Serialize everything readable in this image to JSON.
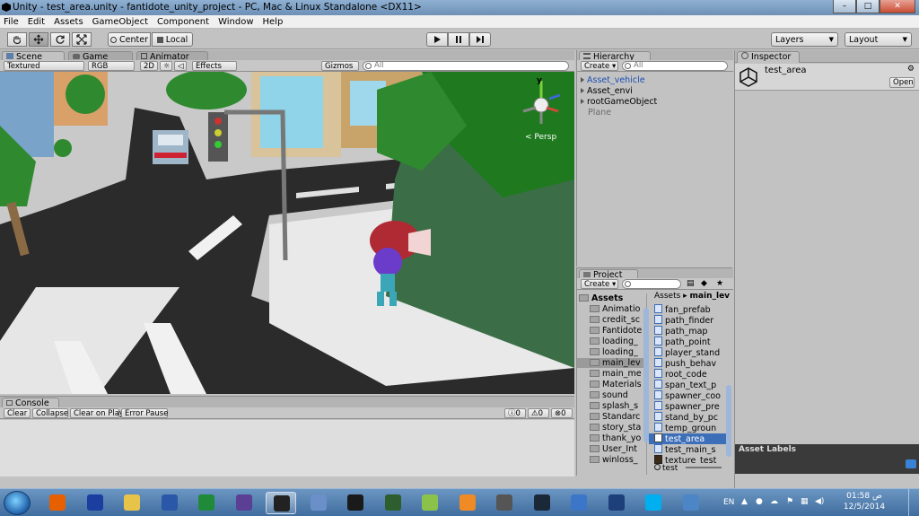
{
  "window": {
    "title": "Unity - test_area.unity - fantidote_unity_project - PC, Mac & Linux Standalone <DX11>",
    "buttons": [
      "minimize",
      "maximize",
      "close"
    ]
  },
  "menu": [
    "File",
    "Edit",
    "Assets",
    "GameObject",
    "Component",
    "Window",
    "Help"
  ],
  "toolbar": {
    "tools": [
      "hand-tool",
      "move-tool",
      "rotate-tool",
      "scale-tool"
    ],
    "pivot": "Center",
    "space": "Local",
    "playback": [
      "play",
      "pause",
      "step"
    ],
    "layers": "Layers",
    "layout": "Layout"
  },
  "scene_tabs": [
    "Scene",
    "Game",
    "Animator"
  ],
  "scene_toolbar": {
    "render_mode": "Textured",
    "channel": "RGB",
    "mode_2d": "2D",
    "effects": "Effects",
    "gizmos": "Gizmos",
    "search_placeholder": "All"
  },
  "scene_view": {
    "persp_label": "Persp",
    "gizmo_axis": "y"
  },
  "hierarchy": {
    "tab": "Hierarchy",
    "create": "Create",
    "search_placeholder": "All",
    "items": [
      {
        "label": "Asset_vehicle",
        "state": "selected"
      },
      {
        "label": "Asset_envi",
        "state": "normal"
      },
      {
        "label": "rootGameObject",
        "state": "normal"
      },
      {
        "label": "Plane",
        "state": "dim"
      }
    ]
  },
  "inspector": {
    "tab": "Inspector",
    "object_name": "test_area",
    "open_button": "Open",
    "asset_labels": "Asset Labels"
  },
  "project": {
    "tab": "Project",
    "create": "Create",
    "breadcrumb_root": "Assets",
    "breadcrumb_current": "main_lev",
    "folders": [
      "Assets",
      "Animatio",
      "credit_sc",
      "Fantidote",
      "loading_",
      "loading_",
      "main_lev",
      "main_me",
      "Materials",
      "sound",
      "splash_s",
      "Standarc",
      "story_sta",
      "thank_yo",
      "User_Int",
      "winloss_"
    ],
    "files": [
      {
        "label": "fan_prefab",
        "icon": "script"
      },
      {
        "label": "path_finder",
        "icon": "script"
      },
      {
        "label": "path_map",
        "icon": "script"
      },
      {
        "label": "path_point",
        "icon": "script"
      },
      {
        "label": "player_stand",
        "icon": "script"
      },
      {
        "label": "push_behav",
        "icon": "script"
      },
      {
        "label": "root_code",
        "icon": "script"
      },
      {
        "label": "span_text_p",
        "icon": "script"
      },
      {
        "label": "spawner_coo",
        "icon": "script"
      },
      {
        "label": "spawner_pre",
        "icon": "script"
      },
      {
        "label": "stand_by_pc",
        "icon": "script"
      },
      {
        "label": "temp_groun",
        "icon": "prefab"
      },
      {
        "label": "test_area",
        "icon": "unity",
        "selected": true
      },
      {
        "label": "test_main_s",
        "icon": "script"
      },
      {
        "label": "texture_test",
        "icon": "texture"
      }
    ],
    "footer_label": "test"
  },
  "console": {
    "tab": "Console",
    "buttons": [
      "Clear",
      "Collapse",
      "Clear on Play",
      "Error Pause"
    ],
    "counts": [
      "0",
      "0",
      "0"
    ]
  },
  "taskbar": {
    "apps": [
      {
        "name": "firefox-icon",
        "color": "#e66000",
        "open": false
      },
      {
        "name": "visual-studio-icon",
        "color": "#1b3fa0",
        "open": false
      },
      {
        "name": "paint-icon",
        "color": "#e8c34a",
        "open": false
      },
      {
        "name": "devexpress-icon",
        "color": "#2a57a8",
        "open": false
      },
      {
        "name": "visual-studio-green-icon",
        "color": "#1f8a3a",
        "open": false
      },
      {
        "name": "eclipse-icon",
        "color": "#5b3f95",
        "open": false
      },
      {
        "name": "unity-icon",
        "color": "#222222",
        "open": true
      },
      {
        "name": "remote-icon",
        "color": "#6b8fc8",
        "open": false
      },
      {
        "name": "udk-icon",
        "color": "#1a1a1a",
        "open": false
      },
      {
        "name": "gear-app-icon",
        "color": "#2e5d2e",
        "open": false
      },
      {
        "name": "gamemaker-icon",
        "color": "#8bc34a",
        "open": false
      },
      {
        "name": "blender-icon",
        "color": "#f08a24",
        "open": false
      },
      {
        "name": "wolf-icon",
        "color": "#555555",
        "open": false
      },
      {
        "name": "steam-icon",
        "color": "#1b2838",
        "open": false
      },
      {
        "name": "windows-explorer-icon",
        "color": "#3c76c9",
        "open": false
      },
      {
        "name": "network-icon",
        "color": "#1d3f7a",
        "open": false
      },
      {
        "name": "skype-icon",
        "color": "#00aff0",
        "open": false
      },
      {
        "name": "server-icon",
        "color": "#4d86c7",
        "open": false
      }
    ],
    "language": "EN",
    "time": "01:58",
    "am_pm": "ص",
    "date": "12/5/2014"
  }
}
